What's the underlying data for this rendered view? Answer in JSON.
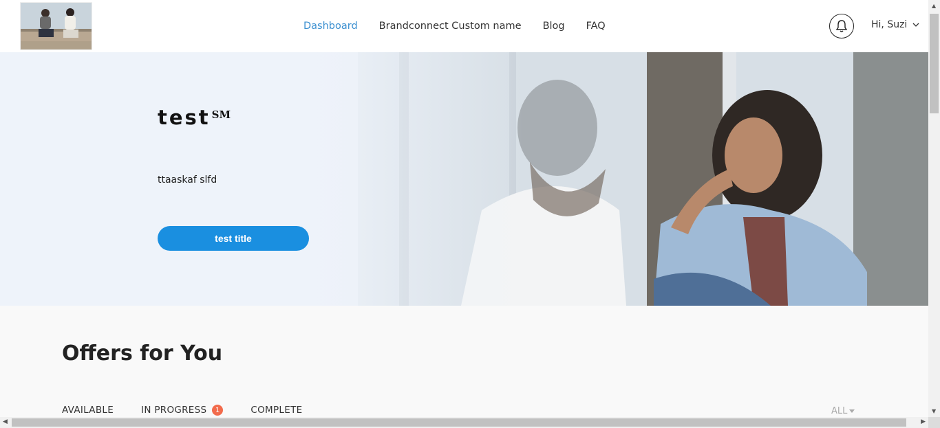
{
  "header": {
    "nav": [
      {
        "label": "Dashboard",
        "active": true
      },
      {
        "label": "Brandconnect Custom name",
        "active": false
      },
      {
        "label": "Blog",
        "active": false
      },
      {
        "label": "FAQ",
        "active": false
      }
    ],
    "greeting": "Hi, Suzi",
    "icons": {
      "notifications": "bell-icon",
      "user_menu": "chevron-down-icon"
    }
  },
  "hero": {
    "title": "test",
    "title_mark": "SM",
    "subtitle": "ttaaskaf slfd",
    "button_label": "test title",
    "button_color": "#1a8fe0"
  },
  "offers": {
    "title": "Offers for You",
    "tabs": [
      {
        "label": "AVAILABLE"
      },
      {
        "label": "IN PROGRESS",
        "badge": "1"
      },
      {
        "label": "COMPLETE"
      }
    ],
    "filter_label": "ALL",
    "badge_color": "#f26b4c"
  },
  "theme": {
    "accent": "#3a8fd0"
  }
}
